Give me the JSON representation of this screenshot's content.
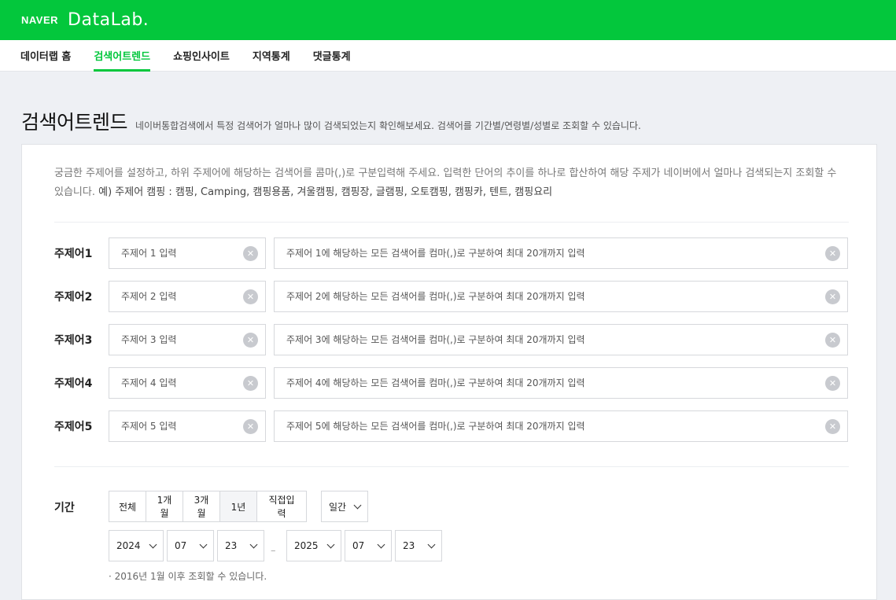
{
  "brand": {
    "naver": "NAVER",
    "datalab": "DataLab."
  },
  "nav": [
    {
      "label": "데이터랩 홈",
      "active": false
    },
    {
      "label": "검색어트렌드",
      "active": true
    },
    {
      "label": "쇼핑인사이트",
      "active": false
    },
    {
      "label": "지역통계",
      "active": false
    },
    {
      "label": "댓글통계",
      "active": false
    }
  ],
  "page": {
    "title": "검색어트렌드",
    "description": "네이버통합검색에서 특정 검색어가 얼마나 많이 검색되었는지 확인해보세요. 검색어를 기간별/연령별/성별로 조회할 수 있습니다."
  },
  "intro": {
    "text": "궁금한 주제어를 설정하고, 하위 주제어에 해당하는 검색어를 콤마(,)로 구분입력해 주세요. 입력한 단어의 추이를 하나로 합산하여 해당 주제가 네이버에서 얼마나 검색되는지 조회할 수 있습니다. ",
    "example": "예) 주제어 캠핑 : 캠핑, Camping, 캠핑용품, 겨울캠핑, 캠핑장, 글램핑, 오토캠핑, 캠핑카, 텐트, 캠핑요리"
  },
  "topics": [
    {
      "label": "주제어1",
      "topic_placeholder": "주제어 1 입력",
      "keywords_placeholder": "주제어 1에 해당하는 모든 검색어를 컴마(,)로 구분하여 최대 20개까지 입력"
    },
    {
      "label": "주제어2",
      "topic_placeholder": "주제어 2 입력",
      "keywords_placeholder": "주제어 2에 해당하는 모든 검색어를 컴마(,)로 구분하여 최대 20개까지 입력"
    },
    {
      "label": "주제어3",
      "topic_placeholder": "주제어 3 입력",
      "keywords_placeholder": "주제어 3에 해당하는 모든 검색어를 컴마(,)로 구분하여 최대 20개까지 입력"
    },
    {
      "label": "주제어4",
      "topic_placeholder": "주제어 4 입력",
      "keywords_placeholder": "주제어 4에 해당하는 모든 검색어를 컴마(,)로 구분하여 최대 20개까지 입력"
    },
    {
      "label": "주제어5",
      "topic_placeholder": "주제어 5 입력",
      "keywords_placeholder": "주제어 5에 해당하는 모든 검색어를 컴마(,)로 구분하여 최대 20개까지 입력"
    }
  ],
  "period": {
    "label": "기간",
    "ranges": [
      {
        "label": "전체",
        "active": false
      },
      {
        "label": "1개월",
        "active": false
      },
      {
        "label": "3개월",
        "active": false
      },
      {
        "label": "1년",
        "active": true
      },
      {
        "label": "직접입력",
        "active": false
      }
    ],
    "interval": "일간",
    "start": {
      "year": "2024",
      "month": "07",
      "day": "23"
    },
    "end": {
      "year": "2025",
      "month": "07",
      "day": "23"
    },
    "separator": "–",
    "note": "· 2016년 1월 이후 조회할 수 있습니다."
  },
  "colors": {
    "brand_green": "#03c73c"
  },
  "icons": {
    "clear": "close-circle-icon",
    "dropdown": "chevron-down-icon"
  }
}
